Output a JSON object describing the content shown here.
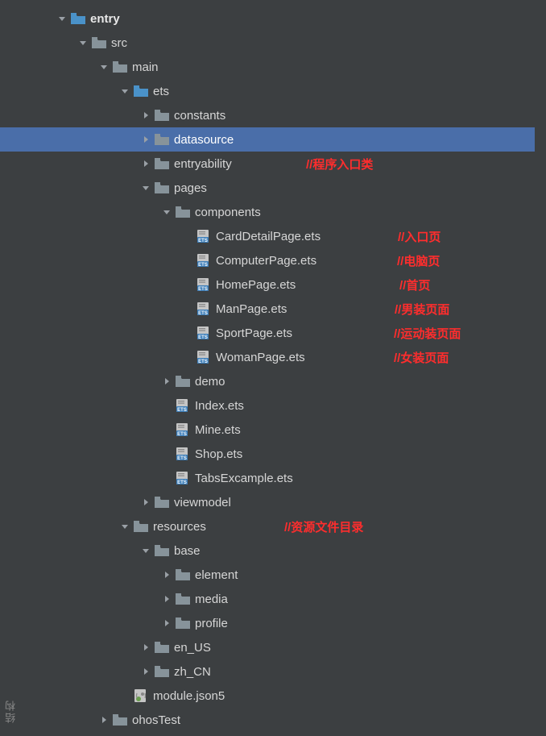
{
  "sidetext": "结构",
  "tree": [
    {
      "depth": 0,
      "arrow": "down",
      "icon": "folder-module",
      "label": "entry",
      "bold": true
    },
    {
      "depth": 1,
      "arrow": "down",
      "icon": "folder",
      "label": "src"
    },
    {
      "depth": 2,
      "arrow": "down",
      "icon": "folder",
      "label": "main"
    },
    {
      "depth": 3,
      "arrow": "down",
      "icon": "folder-src",
      "label": "ets"
    },
    {
      "depth": 4,
      "arrow": "right",
      "icon": "folder",
      "label": "constants"
    },
    {
      "depth": 4,
      "arrow": "right",
      "icon": "folder",
      "label": "datasource",
      "selected": true
    },
    {
      "depth": 4,
      "arrow": "right",
      "icon": "folder",
      "label": "entryability",
      "comment": "//程序入口类",
      "commentX": 352
    },
    {
      "depth": 4,
      "arrow": "down",
      "icon": "folder",
      "label": "pages"
    },
    {
      "depth": 5,
      "arrow": "down",
      "icon": "folder",
      "label": "components"
    },
    {
      "depth": 6,
      "arrow": "none",
      "icon": "ets",
      "label": "CardDetailPage.ets",
      "comment": "//入口页",
      "commentX": 466
    },
    {
      "depth": 6,
      "arrow": "none",
      "icon": "ets",
      "label": "ComputerPage.ets",
      "comment": "//电脑页",
      "commentX": 465
    },
    {
      "depth": 6,
      "arrow": "none",
      "icon": "ets",
      "label": "HomePage.ets",
      "comment": "//首页",
      "commentX": 468
    },
    {
      "depth": 6,
      "arrow": "none",
      "icon": "ets",
      "label": "ManPage.ets",
      "comment": "//男装页面",
      "commentX": 462
    },
    {
      "depth": 6,
      "arrow": "none",
      "icon": "ets",
      "label": "SportPage.ets",
      "comment": "//运动装页面",
      "commentX": 461
    },
    {
      "depth": 6,
      "arrow": "none",
      "icon": "ets",
      "label": "WomanPage.ets",
      "comment": "//女装页面",
      "commentX": 461
    },
    {
      "depth": 5,
      "arrow": "right",
      "icon": "folder",
      "label": "demo"
    },
    {
      "depth": 5,
      "arrow": "none",
      "icon": "ets",
      "label": "Index.ets"
    },
    {
      "depth": 5,
      "arrow": "none",
      "icon": "ets",
      "label": "Mine.ets"
    },
    {
      "depth": 5,
      "arrow": "none",
      "icon": "ets",
      "label": "Shop.ets"
    },
    {
      "depth": 5,
      "arrow": "none",
      "icon": "ets",
      "label": "TabsExcample.ets"
    },
    {
      "depth": 4,
      "arrow": "right",
      "icon": "folder",
      "label": "viewmodel"
    },
    {
      "depth": 3,
      "arrow": "down",
      "icon": "folder",
      "label": "resources",
      "comment": "//资源文件目录",
      "commentX": 325
    },
    {
      "depth": 4,
      "arrow": "down",
      "icon": "folder",
      "label": "base"
    },
    {
      "depth": 5,
      "arrow": "right",
      "icon": "folder",
      "label": "element"
    },
    {
      "depth": 5,
      "arrow": "right",
      "icon": "folder",
      "label": "media"
    },
    {
      "depth": 5,
      "arrow": "right",
      "icon": "folder",
      "label": "profile"
    },
    {
      "depth": 4,
      "arrow": "right",
      "icon": "folder",
      "label": "en_US"
    },
    {
      "depth": 4,
      "arrow": "right",
      "icon": "folder",
      "label": "zh_CN"
    },
    {
      "depth": 3,
      "arrow": "none",
      "icon": "json5",
      "label": "module.json5"
    },
    {
      "depth": 2,
      "arrow": "right",
      "icon": "folder",
      "label": "ohosTest"
    }
  ]
}
